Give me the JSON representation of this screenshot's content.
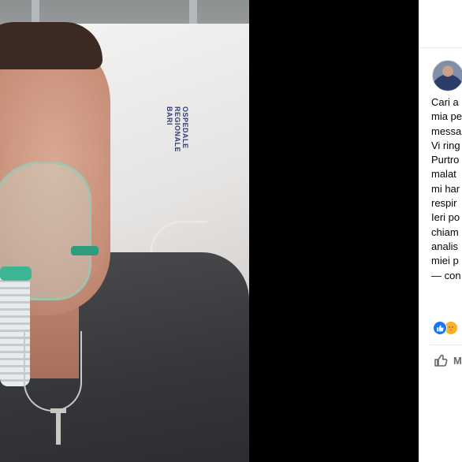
{
  "photo": {
    "pillow_print_lines": [
      "OSPEDALE",
      "REGIONALE",
      "BARI"
    ]
  },
  "post": {
    "text_lines": [
      "Cari a",
      "mia pe",
      "messa",
      "Vi ring",
      "Purtro",
      "malat",
      "mi har",
      "respir",
      "Ieri po",
      "chiam",
      "analis",
      "miei p",
      "— con"
    ]
  },
  "actions": {
    "like_label": "M"
  },
  "colors": {
    "like_blue": "#1877f2",
    "care_yellow": "#f7b125",
    "text_gray": "#65676b"
  }
}
